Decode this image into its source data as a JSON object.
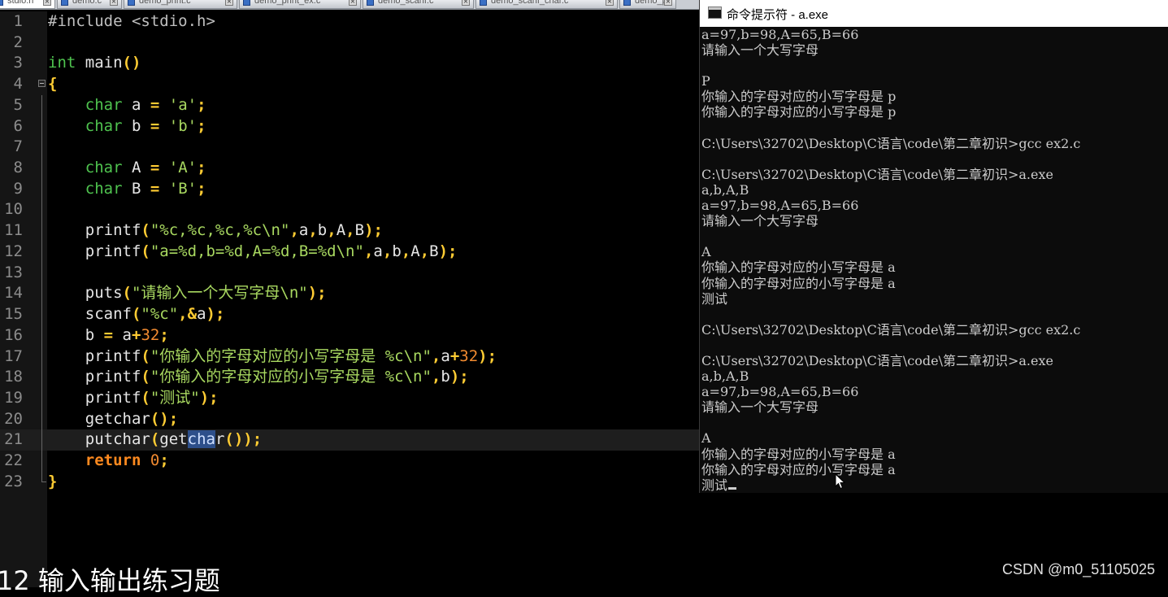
{
  "editor": {
    "tabs": [
      "stdio.h",
      "demo.c",
      "demo_print.c",
      "demo_print_ex.c",
      "demo_scanf.c",
      "demo_scanf_char.c",
      "demo_p"
    ],
    "active_tab": 0,
    "current_line": 21,
    "lines": [
      {
        "n": "1",
        "tokens": [
          {
            "t": "#include <stdio.h>",
            "c": "pre"
          }
        ]
      },
      {
        "n": "2",
        "tokens": []
      },
      {
        "n": "3",
        "tokens": [
          {
            "t": "int",
            "c": "type"
          },
          {
            "t": " main",
            "c": "plain"
          },
          {
            "t": "()",
            "c": "op"
          }
        ]
      },
      {
        "n": "4",
        "tokens": [
          {
            "t": "{",
            "c": "op"
          }
        ]
      },
      {
        "n": "5",
        "tokens": [
          {
            "t": "    ",
            "c": "plain"
          },
          {
            "t": "char",
            "c": "type"
          },
          {
            "t": " a ",
            "c": "plain"
          },
          {
            "t": "=",
            "c": "op"
          },
          {
            "t": " ",
            "c": "plain"
          },
          {
            "t": "'a'",
            "c": "str"
          },
          {
            "t": ";",
            "c": "op"
          }
        ]
      },
      {
        "n": "6",
        "tokens": [
          {
            "t": "    ",
            "c": "plain"
          },
          {
            "t": "char",
            "c": "type"
          },
          {
            "t": " b ",
            "c": "plain"
          },
          {
            "t": "=",
            "c": "op"
          },
          {
            "t": " ",
            "c": "plain"
          },
          {
            "t": "'b'",
            "c": "str"
          },
          {
            "t": ";",
            "c": "op"
          }
        ]
      },
      {
        "n": "7",
        "tokens": []
      },
      {
        "n": "8",
        "tokens": [
          {
            "t": "    ",
            "c": "plain"
          },
          {
            "t": "char",
            "c": "type"
          },
          {
            "t": " A ",
            "c": "plain"
          },
          {
            "t": "=",
            "c": "op"
          },
          {
            "t": " ",
            "c": "plain"
          },
          {
            "t": "'A'",
            "c": "str"
          },
          {
            "t": ";",
            "c": "op"
          }
        ]
      },
      {
        "n": "9",
        "tokens": [
          {
            "t": "    ",
            "c": "plain"
          },
          {
            "t": "char",
            "c": "type"
          },
          {
            "t": " B ",
            "c": "plain"
          },
          {
            "t": "=",
            "c": "op"
          },
          {
            "t": " ",
            "c": "plain"
          },
          {
            "t": "'B'",
            "c": "str"
          },
          {
            "t": ";",
            "c": "op"
          }
        ]
      },
      {
        "n": "10",
        "tokens": []
      },
      {
        "n": "11",
        "tokens": [
          {
            "t": "    printf",
            "c": "plain"
          },
          {
            "t": "(",
            "c": "op"
          },
          {
            "t": "\"%c,%c,%c,%c\\n\"",
            "c": "str"
          },
          {
            "t": ",",
            "c": "op"
          },
          {
            "t": "a",
            "c": "plain"
          },
          {
            "t": ",",
            "c": "op"
          },
          {
            "t": "b",
            "c": "plain"
          },
          {
            "t": ",",
            "c": "op"
          },
          {
            "t": "A",
            "c": "plain"
          },
          {
            "t": ",",
            "c": "op"
          },
          {
            "t": "B",
            "c": "plain"
          },
          {
            "t": ");",
            "c": "op"
          }
        ]
      },
      {
        "n": "12",
        "tokens": [
          {
            "t": "    printf",
            "c": "plain"
          },
          {
            "t": "(",
            "c": "op"
          },
          {
            "t": "\"a=%d,b=%d,A=%d,B=%d\\n\"",
            "c": "str"
          },
          {
            "t": ",",
            "c": "op"
          },
          {
            "t": "a",
            "c": "plain"
          },
          {
            "t": ",",
            "c": "op"
          },
          {
            "t": "b",
            "c": "plain"
          },
          {
            "t": ",",
            "c": "op"
          },
          {
            "t": "A",
            "c": "plain"
          },
          {
            "t": ",",
            "c": "op"
          },
          {
            "t": "B",
            "c": "plain"
          },
          {
            "t": ");",
            "c": "op"
          }
        ]
      },
      {
        "n": "13",
        "tokens": []
      },
      {
        "n": "14",
        "tokens": [
          {
            "t": "    puts",
            "c": "plain"
          },
          {
            "t": "(",
            "c": "op"
          },
          {
            "t": "\"请输入一个大写字母\\n\"",
            "c": "str"
          },
          {
            "t": ");",
            "c": "op"
          }
        ]
      },
      {
        "n": "15",
        "tokens": [
          {
            "t": "    scanf",
            "c": "plain"
          },
          {
            "t": "(",
            "c": "op"
          },
          {
            "t": "\"%c\"",
            "c": "str"
          },
          {
            "t": ",&",
            "c": "op"
          },
          {
            "t": "a",
            "c": "plain"
          },
          {
            "t": ");",
            "c": "op"
          }
        ]
      },
      {
        "n": "16",
        "tokens": [
          {
            "t": "    b ",
            "c": "plain"
          },
          {
            "t": "=",
            "c": "op"
          },
          {
            "t": " a",
            "c": "plain"
          },
          {
            "t": "+",
            "c": "op"
          },
          {
            "t": "32",
            "c": "num"
          },
          {
            "t": ";",
            "c": "op"
          }
        ]
      },
      {
        "n": "17",
        "tokens": [
          {
            "t": "    printf",
            "c": "plain"
          },
          {
            "t": "(",
            "c": "op"
          },
          {
            "t": "\"你输入的字母对应的小写字母是 %c\\n\"",
            "c": "str"
          },
          {
            "t": ",",
            "c": "op"
          },
          {
            "t": "a",
            "c": "plain"
          },
          {
            "t": "+",
            "c": "op"
          },
          {
            "t": "32",
            "c": "num"
          },
          {
            "t": ");",
            "c": "op"
          }
        ]
      },
      {
        "n": "18",
        "tokens": [
          {
            "t": "    printf",
            "c": "plain"
          },
          {
            "t": "(",
            "c": "op"
          },
          {
            "t": "\"你输入的字母对应的小写字母是 %c\\n\"",
            "c": "str"
          },
          {
            "t": ",",
            "c": "op"
          },
          {
            "t": "b",
            "c": "plain"
          },
          {
            "t": ");",
            "c": "op"
          }
        ]
      },
      {
        "n": "19",
        "tokens": [
          {
            "t": "    printf",
            "c": "plain"
          },
          {
            "t": "(",
            "c": "op"
          },
          {
            "t": "\"测试\"",
            "c": "str"
          },
          {
            "t": ");",
            "c": "op"
          }
        ]
      },
      {
        "n": "20",
        "tokens": [
          {
            "t": "    getchar",
            "c": "plain"
          },
          {
            "t": "();",
            "c": "op"
          }
        ]
      },
      {
        "n": "21",
        "tokens": [
          {
            "t": "    putchar",
            "c": "plain"
          },
          {
            "t": "(",
            "c": "op"
          },
          {
            "t": "get",
            "c": "plain"
          },
          {
            "t": "cha",
            "c": "sel"
          },
          {
            "t": "r",
            "c": "plain"
          },
          {
            "t": "());",
            "c": "op"
          }
        ]
      },
      {
        "n": "22",
        "tokens": [
          {
            "t": "    ",
            "c": "plain"
          },
          {
            "t": "return",
            "c": "kw"
          },
          {
            "t": " ",
            "c": "plain"
          },
          {
            "t": "0",
            "c": "num"
          },
          {
            "t": ";",
            "c": "op"
          }
        ]
      },
      {
        "n": "23",
        "tokens": [
          {
            "t": "}",
            "c": "op"
          }
        ]
      }
    ]
  },
  "console": {
    "title": "命令提示符 - a.exe",
    "lines": [
      "a=97,b=98,A=65,B=66",
      "请输入一个大写字母",
      "",
      "P",
      "你输入的字母对应的小写字母是 p",
      "你输入的字母对应的小写字母是 p",
      "",
      "C:\\Users\\32702\\Desktop\\C语言\\code\\第二章初识>gcc ex2.c",
      "",
      "C:\\Users\\32702\\Desktop\\C语言\\code\\第二章初识>a.exe",
      "a,b,A,B",
      "a=97,b=98,A=65,B=66",
      "请输入一个大写字母",
      "",
      "A",
      "你输入的字母对应的小写字母是 a",
      "你输入的字母对应的小写字母是 a",
      "测试",
      "",
      "C:\\Users\\32702\\Desktop\\C语言\\code\\第二章初识>gcc ex2.c",
      "",
      "C:\\Users\\32702\\Desktop\\C语言\\code\\第二章初识>a.exe",
      "a,b,A,B",
      "a=97,b=98,A=65,B=66",
      "请输入一个大写字母",
      "",
      "A",
      "你输入的字母对应的小写字母是 a",
      "你输入的字母对应的小写字母是 a",
      "测试"
    ]
  },
  "page": {
    "heading": "12 输入输出练习题",
    "watermark": "CSDN @m0_51105025"
  }
}
